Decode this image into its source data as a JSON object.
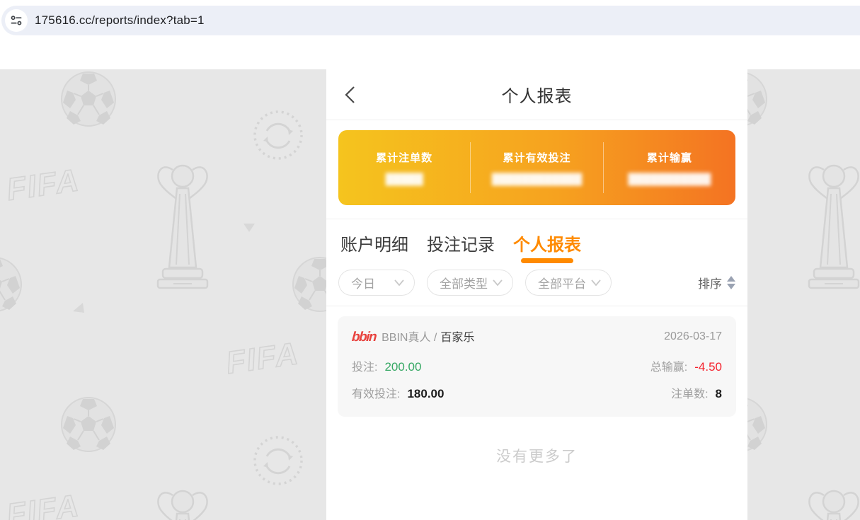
{
  "browser": {
    "url": "175616.cc/reports/index?tab=1",
    "site_icon": "site-settings-icon"
  },
  "colors": {
    "accent_orange": "#FF8A00",
    "summary_gradient_start": "#F5C41E",
    "summary_gradient_end": "#F47322",
    "positive_green": "#36A864",
    "negative_red": "#F5222D",
    "logo_red": "#E8423E",
    "page_background": "#E7E7E7"
  },
  "header": {
    "title": "个人报表",
    "back_icon": "chevron-left-icon"
  },
  "summary": {
    "items": [
      {
        "label": "累计注单数",
        "value_masked": "█████"
      },
      {
        "label": "累计有效投注",
        "value_masked": "████████████"
      },
      {
        "label": "累计输赢",
        "value_masked": "███████████"
      }
    ]
  },
  "tabs": [
    {
      "label": "账户明细",
      "active": false
    },
    {
      "label": "投注记录",
      "active": false
    },
    {
      "label": "个人报表",
      "active": true
    }
  ],
  "filters": {
    "dropdowns": [
      {
        "label": "今日"
      },
      {
        "label": "全部类型"
      },
      {
        "label": "全部平台"
      }
    ],
    "sort_label": "排序"
  },
  "records": [
    {
      "logo": "bbin",
      "provider": "BBIN真人 /",
      "game": "百家乐",
      "date": "2026-03-17",
      "bet_label": "投注:",
      "bet_value": "200.00",
      "winloss_label": "总输赢:",
      "winloss_value": "-4.50",
      "valid_label": "有效投注:",
      "valid_value": "180.00",
      "count_label": "注单数:",
      "count_value": "8"
    }
  ],
  "empty_text": "没有更多了"
}
